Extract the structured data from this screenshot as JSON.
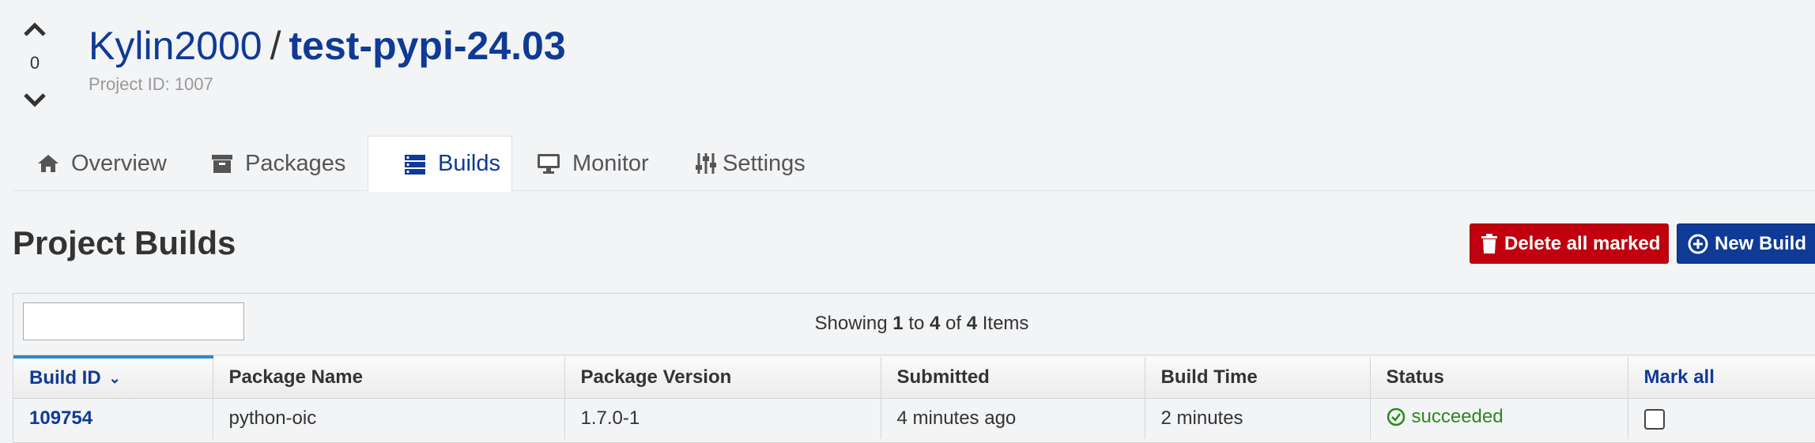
{
  "vote": {
    "count": "0"
  },
  "header": {
    "owner": "Kylin2000",
    "separator": "/",
    "project": "test-pypi-24.03",
    "project_id": "Project ID: 1007"
  },
  "tabs": [
    {
      "label": "Overview",
      "icon": "home-icon"
    },
    {
      "label": "Packages",
      "icon": "archive-icon"
    },
    {
      "label": "Builds",
      "icon": "server-icon",
      "active": true
    },
    {
      "label": "Monitor",
      "icon": "desktop-icon"
    },
    {
      "label": "Settings",
      "icon": "sliders-icon"
    }
  ],
  "section": {
    "title": "Project Builds"
  },
  "actions": {
    "delete_label": "Delete all marked",
    "new_label": "New Build"
  },
  "table": {
    "filter_placeholder": "",
    "showing": {
      "prefix": "Showing",
      "from": "1",
      "to_word": "to",
      "to": "4",
      "of_word": "of",
      "total": "4",
      "suffix": "Items"
    },
    "columns": [
      "Build ID",
      "Package Name",
      "Package Version",
      "Submitted",
      "Build Time",
      "Status",
      "Mark all"
    ],
    "rows": [
      {
        "build_id": "109754",
        "package": "python-oic",
        "version": "1.7.0-1",
        "submitted": "4 minutes ago",
        "build_time": "2 minutes",
        "status": "succeeded"
      }
    ]
  },
  "colors": {
    "link": "#0f3a96",
    "danger": "#c0000f",
    "primary": "#0f3a96",
    "success": "#2a8a1b",
    "sort_indicator": "#2d89cd"
  }
}
